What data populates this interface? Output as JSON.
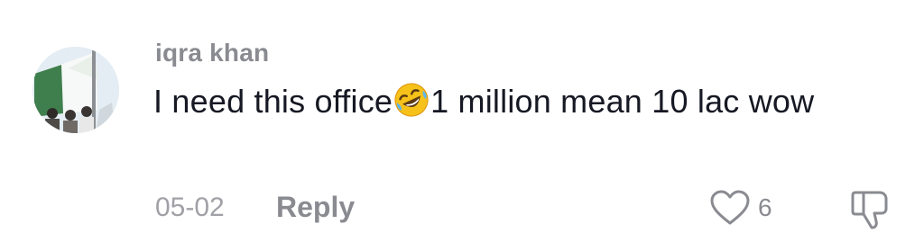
{
  "comment": {
    "username": "iqra khan",
    "text_before_emoji": "I need this office",
    "emoji": "rolling-on-floor-laughing",
    "text_after_emoji": "1 million mean 10 lac wow",
    "date": "05-02",
    "reply_label": "Reply",
    "like_count": "6",
    "avatar_icon": "avatar-flag-photo",
    "like_icon": "heart-outline-icon",
    "dislike_icon": "thumbs-down-icon"
  },
  "colors": {
    "text_primary": "#161823",
    "text_secondary": "#8a8b91",
    "text_tertiary": "#a0a1a6",
    "background": "#ffffff"
  }
}
